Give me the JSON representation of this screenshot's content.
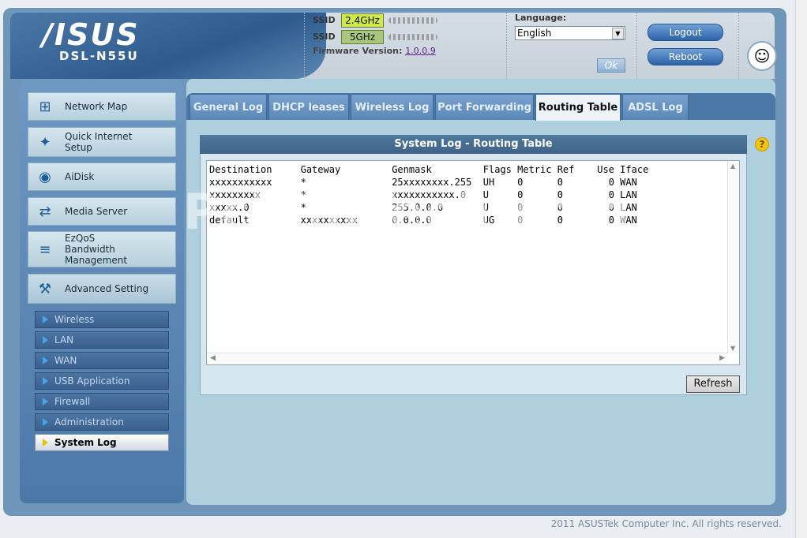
{
  "header": {
    "brand": "/ISUS",
    "model": "DSL-N55U",
    "ssid_label": "SSID",
    "band_24": "2.4GHz",
    "band_5": "5GHz",
    "firmware_label": "Firmware Version:",
    "firmware_version": "1.0.0.9",
    "language_label": "Language:",
    "language_value": "English",
    "ok_label": "Ok",
    "logout_label": "Logout",
    "reboot_label": "Reboot"
  },
  "sidebar": {
    "items": [
      {
        "label": "Network Map",
        "icon": "network-map-icon"
      },
      {
        "label": "Quick Internet Setup",
        "icon": "wand-icon"
      },
      {
        "label": "AiDisk",
        "icon": "disk-icon"
      },
      {
        "label": "Media Server",
        "icon": "media-server-icon"
      },
      {
        "label": "EzQoS Bandwidth Management",
        "icon": "qos-icon"
      },
      {
        "label": "Advanced Setting",
        "icon": "tools-icon"
      }
    ],
    "sub_items": [
      {
        "label": "Wireless"
      },
      {
        "label": "LAN"
      },
      {
        "label": "WAN"
      },
      {
        "label": "USB Application"
      },
      {
        "label": "Firewall"
      },
      {
        "label": "Administration"
      },
      {
        "label": "System Log"
      }
    ]
  },
  "tabs": [
    {
      "label": "General Log"
    },
    {
      "label": "DHCP leases"
    },
    {
      "label": "Wireless Log"
    },
    {
      "label": "Port Forwarding"
    },
    {
      "label": "Routing Table"
    },
    {
      "label": "ADSL Log"
    }
  ],
  "panel": {
    "title": "System Log - Routing Table",
    "refresh_label": "Refresh"
  },
  "routing_table": {
    "header": "Destination     Gateway         Genmask         Flags Metric Ref    Use Iface",
    "rows": [
      "xxxxxxxxxxx     *               25xxxxxxxx.255  UH    0      0        0 WAN",
      "xxxxxxxxx       *               xxxxxxxxxxx.0   U     0      0        0 LAN",
      "xxxxx.0         *               255.0.0.0       U     0      0        0 LAN",
      "default         xxxxxxxxxx      0.0.0.0         UG    0      0        0 WAN"
    ]
  },
  "watermark": "PcWinTech.com",
  "footer": "2011 ASUSTek Computer Inc. All rights reserved."
}
